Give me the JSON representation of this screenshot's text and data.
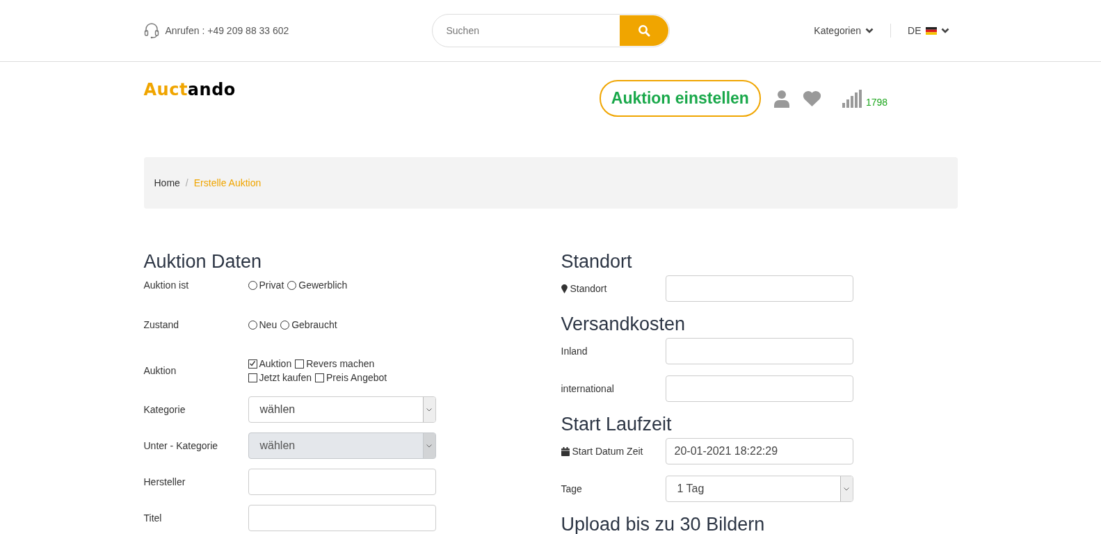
{
  "topbar": {
    "phone": "Anrufen : +49 209 88 33 602",
    "search": {
      "placeholder": "Suchen"
    },
    "categories": "Kategorien",
    "language": "DE"
  },
  "header": {
    "logo": [
      {
        "text": "Auct",
        "accent": true
      },
      {
        "text": "ando",
        "accent": false
      }
    ],
    "cta": "Auktion einstellen",
    "count": "1798"
  },
  "breadcrumb": [
    {
      "label": "Home",
      "selected": false
    },
    {
      "label": "Erstelle Auktion",
      "selected": true
    }
  ],
  "breadcrumb_separator": "/",
  "left": {
    "title": "Auktion Daten",
    "rows": [
      {
        "kind": "radio",
        "label": "Auktion ist",
        "options": [
          {
            "label": "Privat",
            "checked": false
          },
          {
            "label": "Gewerblich",
            "checked": false
          }
        ]
      },
      {
        "kind": "radio",
        "label": "Zustand",
        "options": [
          {
            "label": "Neu",
            "checked": false
          },
          {
            "label": "Gebraucht",
            "checked": false
          }
        ]
      },
      {
        "kind": "checkbox",
        "label": "Auktion",
        "options": [
          {
            "label": "Auktion",
            "checked": true
          },
          {
            "label": "Revers machen",
            "checked": false
          },
          {
            "label": "Jetzt kaufen",
            "checked": false
          },
          {
            "label": "Preis Angebot",
            "checked": false
          }
        ]
      },
      {
        "kind": "select",
        "label": "Kategorie",
        "value": "wählen",
        "disabled": false
      },
      {
        "kind": "select",
        "label": "Unter - Kategorie",
        "value": "wählen",
        "disabled": true
      },
      {
        "kind": "text",
        "label": "Hersteller"
      },
      {
        "kind": "text",
        "label": "Titel"
      }
    ]
  },
  "right": {
    "sections": [
      {
        "title": "Standort",
        "rows": [
          {
            "kind": "location",
            "label": "Standort"
          }
        ]
      },
      {
        "title": "Versandkosten",
        "rows": [
          {
            "kind": "text",
            "label": "Inland"
          },
          {
            "kind": "text",
            "label": "international"
          }
        ]
      },
      {
        "title": "Start Laufzeit",
        "rows": [
          {
            "kind": "date",
            "label": "Start Datum Zeit",
            "value": "20-01-2021 18:22:29"
          },
          {
            "kind": "select",
            "label": "Tage",
            "value": "1 Tag",
            "disabled": false
          }
        ]
      },
      {
        "title": "Upload bis zu 30 Bildern"
      }
    ]
  }
}
